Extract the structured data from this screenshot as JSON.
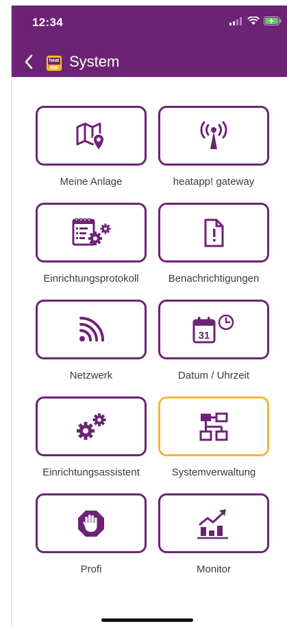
{
  "status_bar": {
    "time": "12:34",
    "signal_icon": "signal-bars-icon",
    "wifi_icon": "wifi-icon",
    "battery_icon": "battery-charging-icon"
  },
  "nav": {
    "back_icon": "chevron-left-icon",
    "logo_text": "heat app",
    "title": "System"
  },
  "colors": {
    "brand": "#6c2375",
    "selected_border": "#f0b540"
  },
  "tiles": [
    {
      "label": "Meine Anlage",
      "icon": "map-pin-icon"
    },
    {
      "label": "heatapp! gateway",
      "icon": "antenna-icon"
    },
    {
      "label": "Einrichtungsprotokoll",
      "icon": "checklist-gears-icon"
    },
    {
      "label": "Benachrichtigungen",
      "icon": "document-alert-icon"
    },
    {
      "label": "Netzwerk",
      "icon": "wireless-signal-icon"
    },
    {
      "label": "Datum / Uhrzeit",
      "icon": "calendar-clock-icon"
    },
    {
      "label": "Einrichtungsassistent",
      "icon": "gears-icon"
    },
    {
      "label": "Systemverwaltung",
      "icon": "network-hierarchy-icon",
      "selected": true
    },
    {
      "label": "Profi",
      "icon": "hand-stop-icon"
    },
    {
      "label": "Monitor",
      "icon": "bar-chart-trend-icon"
    }
  ],
  "calendar_day": "31"
}
